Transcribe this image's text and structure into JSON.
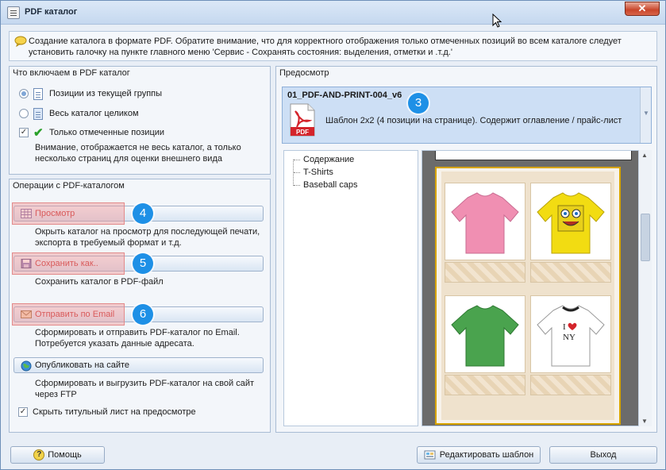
{
  "window": {
    "title": "PDF  каталог",
    "close_label": "✕"
  },
  "info": {
    "text": "Создание каталога в формате PDF. Обратите внимание, что для корректного отображения только отмеченных позиций во всем каталоге следует установить галочку на пункте главного меню 'Сервис - Сохранять состояния: выделения, отметки и .т.д.'"
  },
  "include_group": {
    "title": "Что включаем в PDF каталог",
    "options": [
      {
        "label": "Позиции из текущей группы",
        "checked": true
      },
      {
        "label": "Весь каталог целиком",
        "checked": false
      },
      {
        "label": "Только отмеченные позиции",
        "checked": true
      }
    ],
    "note": "Внимание, отображается не весь каталог, а только несколько страниц для оценки внешнего вида"
  },
  "ops_group": {
    "title": "Операции с PDF-каталогом",
    "preview_label": "Просмотр",
    "preview_note": "Окрыть каталог на просмотр для последующей печати, экспорта в требуемый формат и т.д.",
    "save_label": "Сохранить как..",
    "save_note": "Сохранить каталог в PDF-файл",
    "email_label": "Отправить по Email",
    "email_note": "Сформировать и отправить PDF-каталог по Email. Потребуется указать данные адресата.",
    "publish_label": "Опубликовать на сайте",
    "publish_note": "Сформировать и выгрузить PDF-каталог на свой сайт через FTP",
    "hide_title_label": "Скрыть титульный лист на предосмотре",
    "hide_title_checked": true
  },
  "badges": {
    "b3": "3",
    "b4": "4",
    "b5": "5",
    "b6": "6"
  },
  "preview_group": {
    "title": "Предосмотр",
    "template_name": "01_PDF-AND-PRINT-004_v6",
    "template_desc": "Шаблон 2x2 (4 позиции на странице). Содержит оглавление / прайс-лист",
    "pdf_icon_text": "PDF",
    "tree": [
      "Содержание",
      "T-Shirts",
      "Baseball caps"
    ]
  },
  "buttons": {
    "help": "Помощь",
    "edit_template": "Редактировать шаблон",
    "exit": "Выход"
  },
  "colors": {
    "accent": "#1e90e6",
    "highlight": "#e38a8a",
    "tshirt_pink": "#f08fb2",
    "tshirt_yellow": "#f2dc12",
    "tshirt_green": "#4aa34e",
    "tshirt_white": "#ffffff"
  }
}
